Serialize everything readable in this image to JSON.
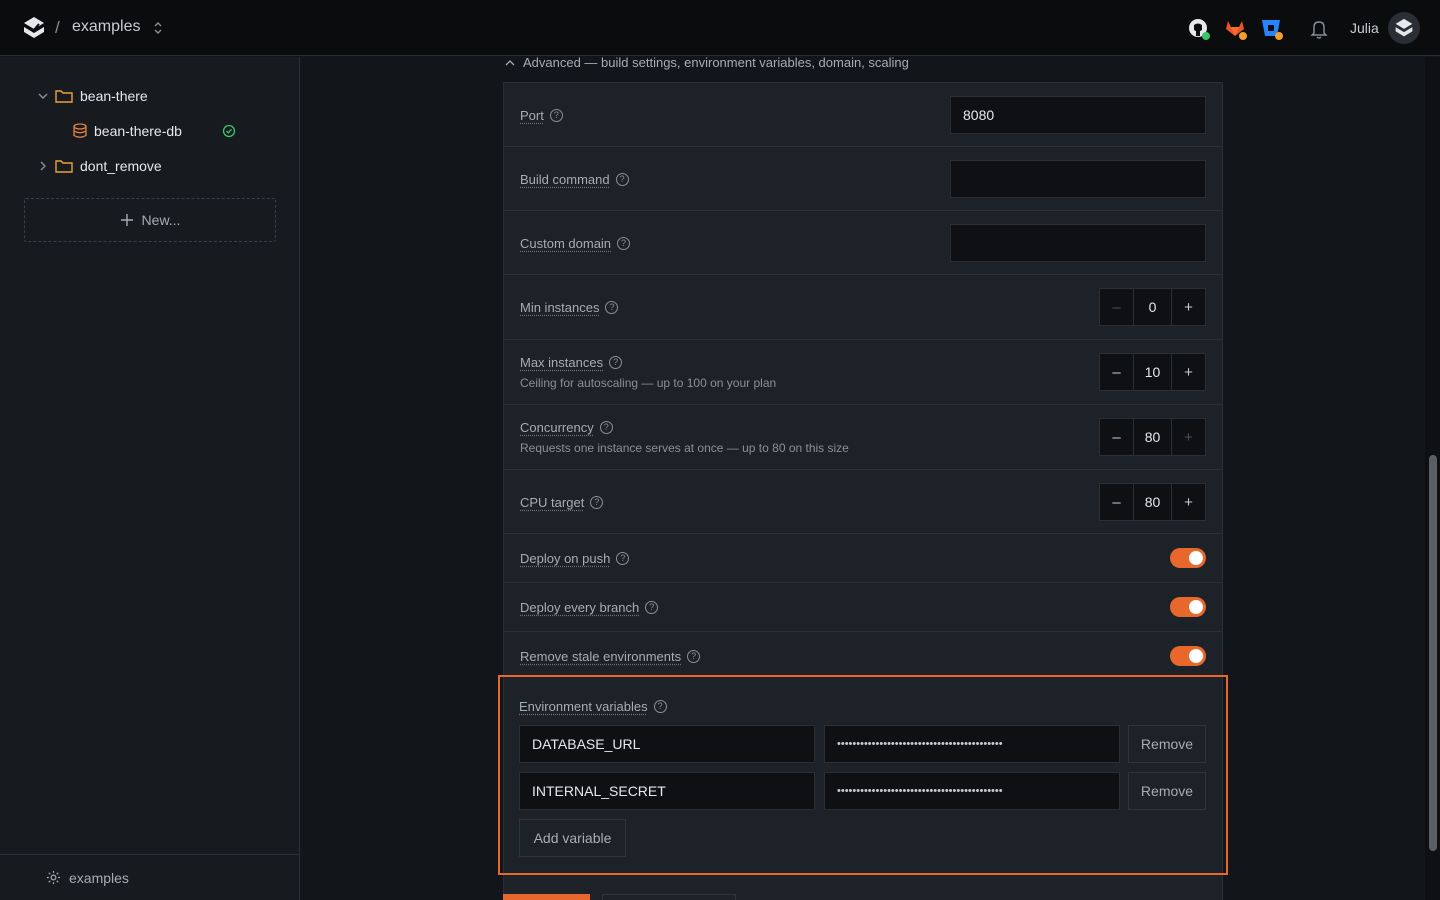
{
  "topbar": {
    "separator": "/",
    "project_name": "examples",
    "user_name": "Julia"
  },
  "sidebar": {
    "tree": [
      {
        "label": "bean-there",
        "expanded": true,
        "icon": "folder-icon"
      },
      {
        "label": "bean-there-db",
        "icon": "database-icon",
        "status": "healthy"
      },
      {
        "label": "dont_remove",
        "expanded": false,
        "icon": "folder-icon"
      }
    ],
    "new_label": "New...",
    "footer_label": "examples"
  },
  "advanced": {
    "header": "Advanced — build settings, environment variables, domain, scaling"
  },
  "settings": {
    "port": {
      "label": "Port",
      "value": "8080"
    },
    "build_command": {
      "label": "Build command",
      "value": ""
    },
    "custom_domain": {
      "label": "Custom domain",
      "value": ""
    },
    "min_instances": {
      "label": "Min instances",
      "value": "0",
      "minus": "–",
      "plus": "+"
    },
    "max_instances": {
      "label": "Max instances",
      "hint": "Ceiling for autoscaling — up to 100 on your plan",
      "value": "10",
      "minus": "–",
      "plus": "+"
    },
    "concurrency": {
      "label": "Concurrency",
      "hint": "Requests one instance serves at once — up to 80 on this size",
      "value": "80",
      "minus": "–",
      "plus": "+"
    },
    "cpu_target": {
      "label": "CPU target",
      "value": "80",
      "minus": "–",
      "plus": "+"
    },
    "deploy_on_push": {
      "label": "Deploy on push",
      "enabled": true
    },
    "deploy_every_branch": {
      "label": "Deploy every branch",
      "enabled": true
    },
    "remove_stale": {
      "label": "Remove stale environments",
      "enabled": true
    }
  },
  "env": {
    "label": "Environment variables",
    "vars": [
      {
        "key": "DATABASE_URL",
        "value": "•••••••••••••••••••••••••••••••••••••••••••",
        "remove": "Remove"
      },
      {
        "key": "INTERNAL_SECRET",
        "value": "•••••••••••••••••••••••••••••••••••••••••••",
        "remove": "Remove"
      }
    ],
    "add_label": "Add variable"
  },
  "colors": {
    "accent": "#e8672c",
    "success": "#3ec46d",
    "background": "#121519",
    "panel": "#1d2128"
  }
}
